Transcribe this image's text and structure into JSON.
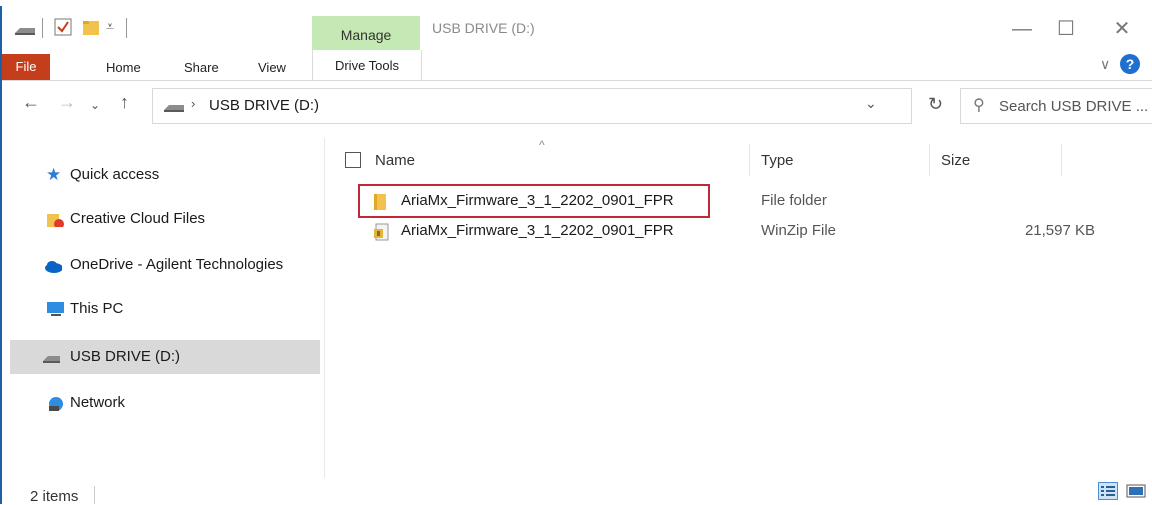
{
  "title_bar": {
    "manage_label": "Manage",
    "window_title": "USB DRIVE (D:)",
    "minimize_glyph": "—",
    "maximize_glyph": "☐",
    "close_glyph": "✕"
  },
  "ribbon": {
    "file_label": "File",
    "tabs": [
      "Home",
      "Share",
      "View"
    ],
    "drive_tools_label": "Drive Tools"
  },
  "address": {
    "path_label": "USB DRIVE (D:)",
    "search_placeholder": "Search USB DRIVE ..."
  },
  "sidebar": {
    "items": [
      {
        "label": "Quick access",
        "icon": "star-icon"
      },
      {
        "label": "Creative Cloud Files",
        "icon": "cloud-folder-icon"
      },
      {
        "label": "OneDrive - Agilent Technologies",
        "icon": "onedrive-cloud-icon"
      },
      {
        "label": "This PC",
        "icon": "computer-icon"
      },
      {
        "label": "USB DRIVE (D:)",
        "icon": "usb-drive-icon"
      },
      {
        "label": "Network",
        "icon": "network-icon"
      }
    ]
  },
  "file_list": {
    "columns": [
      "Name",
      "Type",
      "Size"
    ],
    "rows": [
      {
        "name": "AriaMx_Firmware_3_1_2202_0901_FPR",
        "type": "File folder",
        "size": ""
      },
      {
        "name": "AriaMx_Firmware_3_1_2202_0901_FPR",
        "type": "WinZip File",
        "size": "21,597 KB"
      }
    ]
  },
  "status": {
    "item_count": "2 items"
  },
  "colors": {
    "accent": "#1f5fa8",
    "file_tab": "#c43e1c",
    "manage_tab": "#c5e9b4",
    "highlight": "#c0283a"
  }
}
